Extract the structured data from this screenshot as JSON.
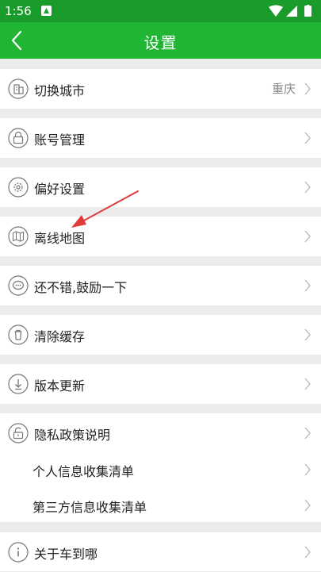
{
  "status_bar": {
    "time": "1:56"
  },
  "app_bar": {
    "title": "设置"
  },
  "items": {
    "city": {
      "label": "切换城市",
      "value": "重庆"
    },
    "account": {
      "label": "账号管理"
    },
    "preferences": {
      "label": "偏好设置"
    },
    "offline_map": {
      "label": "离线地图"
    },
    "rate": {
      "label": "还不错,鼓励一下"
    },
    "clear_cache": {
      "label": "清除缓存"
    },
    "update": {
      "label": "版本更新"
    },
    "privacy": {
      "label": "隐私政策说明"
    },
    "personal_info": {
      "label": "个人信息收集清单"
    },
    "third_party": {
      "label": "第三方信息收集清单"
    },
    "about": {
      "label": "关于车到哪"
    }
  },
  "colors": {
    "status_bar": "#1a9c2c",
    "app_bar": "#20b634",
    "background": "#ececec",
    "annotation_arrow": "#e03a3a"
  }
}
